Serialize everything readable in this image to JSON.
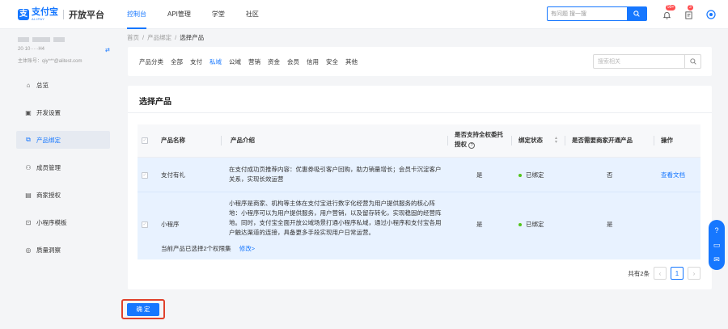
{
  "header": {
    "logo_cn": "支付宝",
    "logo_en": "ALIPAY",
    "platform": "开放平台",
    "nav": [
      {
        "label": "控制台",
        "active": true
      },
      {
        "label": "API管理",
        "active": false
      },
      {
        "label": "学堂",
        "active": false
      },
      {
        "label": "社区",
        "active": false
      }
    ],
    "search_placeholder": "有问题 搜一搜",
    "notification_badge": "99+",
    "task_badge": "3"
  },
  "sidebar": {
    "account_id": "20·10·····H4",
    "account_main": "主体账号：qiy***@alitest.com",
    "items": [
      {
        "label": "总览",
        "icon": "home-icon",
        "active": false
      },
      {
        "label": "开发设置",
        "icon": "settings-doc-icon",
        "active": false
      },
      {
        "label": "产品绑定",
        "icon": "bind-icon",
        "active": true
      },
      {
        "label": "成员管理",
        "icon": "members-icon",
        "active": false
      },
      {
        "label": "商家授权",
        "icon": "authorize-icon",
        "active": false
      },
      {
        "label": "小程序模板",
        "icon": "template-icon",
        "active": false
      },
      {
        "label": "质量洞察",
        "icon": "quality-icon",
        "active": false
      }
    ]
  },
  "breadcrumb": [
    "首页",
    "产品绑定",
    "选择产品"
  ],
  "filter": {
    "label": "产品分类",
    "tabs": [
      {
        "label": "全部",
        "active": false
      },
      {
        "label": "支付",
        "active": false
      },
      {
        "label": "私域",
        "active": true
      },
      {
        "label": "公域",
        "active": false
      },
      {
        "label": "营销",
        "active": false
      },
      {
        "label": "资金",
        "active": false
      },
      {
        "label": "会员",
        "active": false
      },
      {
        "label": "信用",
        "active": false
      },
      {
        "label": "安全",
        "active": false
      },
      {
        "label": "其他",
        "active": false
      }
    ],
    "search_placeholder": "搜索相关"
  },
  "card": {
    "title": "选择产品",
    "columns": {
      "name": "产品名称",
      "intro": "产品介绍",
      "full_auth": "是否支持全权委托授权",
      "status": "绑定状态",
      "merchant": "是否需要商家开通产品",
      "action": "操作"
    },
    "rows": [
      {
        "name": "支付有礼",
        "intro": "在支付成功页推荐内容：优惠券吸引客户回购，助力销量增长；会员卡沉淀客户关系，实现长效运营",
        "full_auth": "是",
        "status": "已绑定",
        "merchant": "否",
        "action": "查看文档"
      },
      {
        "name": "小程序",
        "intro": "小程序是商家、机构等主体在支付宝进行数字化经营为用户提供服务的核心阵地：小程序可以为用户提供服务，用户营销，以及留存转化，实现稳固的经营阵地。同时，支付宝全面开放公域场景打通小程序私域，通过小程序和支付宝各用户触达渠道的连接，具备更多手段实现用户日常运营。",
        "full_auth": "是",
        "status": "已绑定",
        "merchant": "是",
        "action": ""
      }
    ],
    "summary_text": "当前产品已选择2个权限集",
    "summary_link": "修改>",
    "pager_total": "共有2条",
    "pager_current": "1",
    "confirm": "确 定"
  },
  "colors": {
    "accent": "#1677ff",
    "highlight_row": "#e8f2ff",
    "confirm_outline": "#e0412c",
    "status_ok": "#52c41a"
  }
}
